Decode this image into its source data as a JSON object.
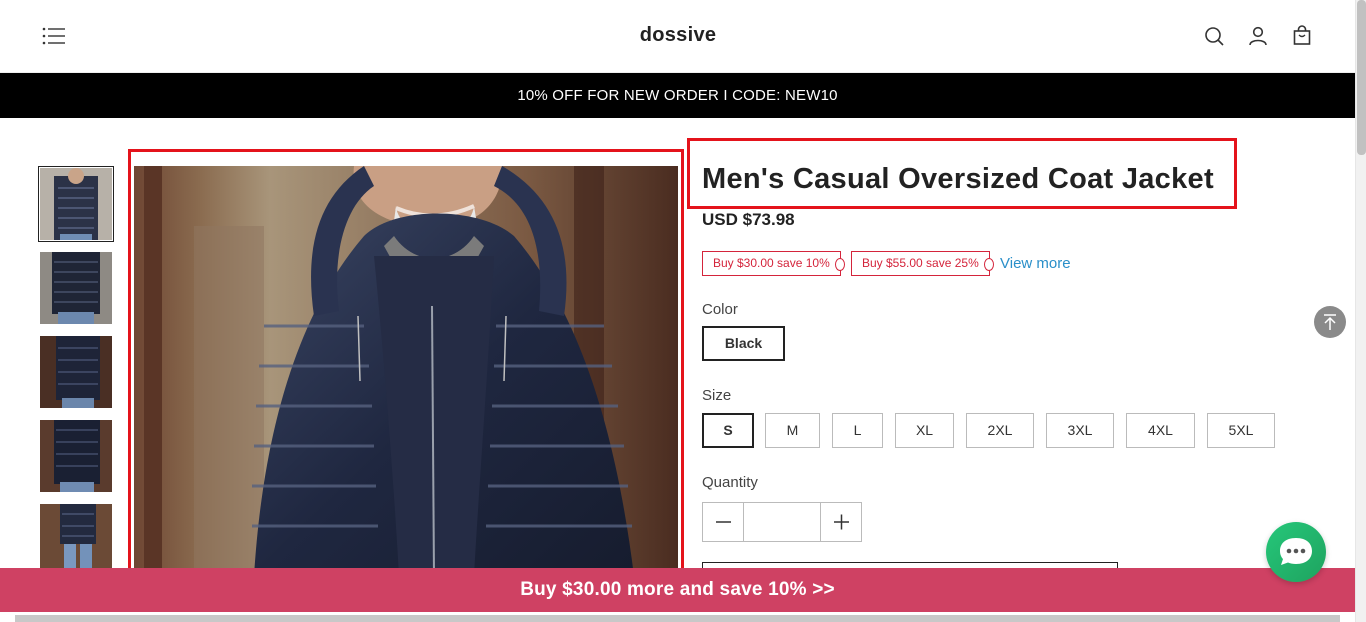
{
  "header": {
    "brand": "dossive",
    "icons": [
      "menu-icon",
      "search-icon",
      "account-icon",
      "cart-icon"
    ]
  },
  "announcement": {
    "text": "10% OFF FOR NEW ORDER I CODE: NEW10"
  },
  "product": {
    "title": "Men's Casual Oversized Coat Jacket",
    "price": "USD $73.98",
    "coupons": [
      {
        "label": "Buy $30.00 save 10%"
      },
      {
        "label": "Buy $55.00 save 25%"
      }
    ],
    "view_more": "View more",
    "color_label": "Color",
    "colors": [
      {
        "label": "Black",
        "selected": true
      }
    ],
    "size_label": "Size",
    "sizes": [
      {
        "label": "S",
        "selected": true
      },
      {
        "label": "M"
      },
      {
        "label": "L"
      },
      {
        "label": "XL"
      },
      {
        "label": "2XL"
      },
      {
        "label": "3XL"
      },
      {
        "label": "4XL"
      },
      {
        "label": "5XL"
      }
    ],
    "quantity_label": "Quantity",
    "quantity_value": ""
  },
  "promo_bar": {
    "text": "Buy $30.00 more and save 10%  >>"
  },
  "colors": {
    "accent_red": "#e4131b",
    "promo_pink": "#cf4163",
    "coupon_red": "#d4243b",
    "link_blue": "#2a8fc9",
    "chat_green": "#25c77a"
  }
}
